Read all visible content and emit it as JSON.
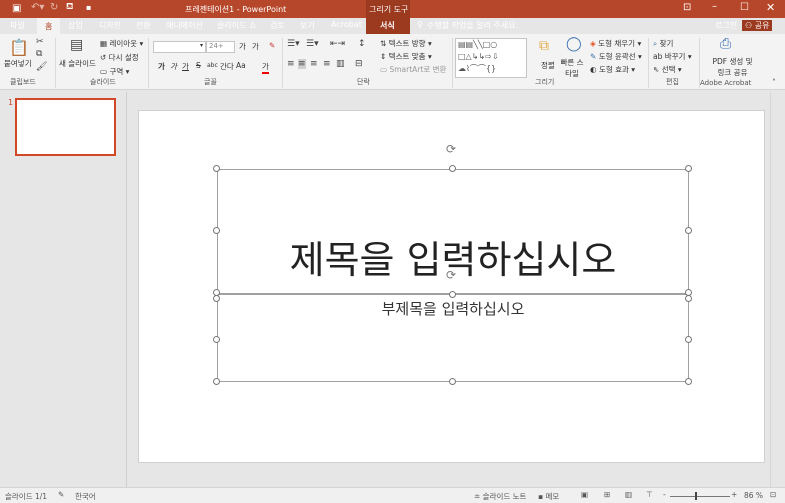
{
  "window": {
    "title": "프레젠테이션1 - PowerPoint",
    "context_tab_group": "그리기 도구"
  },
  "tabs": [
    {
      "label": "파일"
    },
    {
      "label": "홈"
    },
    {
      "label": "삽입"
    },
    {
      "label": "디자인"
    },
    {
      "label": "전환"
    },
    {
      "label": "애니메이션"
    },
    {
      "label": "슬라이드 쇼"
    },
    {
      "label": "검토"
    },
    {
      "label": "보기"
    },
    {
      "label": "Acrobat"
    },
    {
      "label": "서식"
    }
  ],
  "tell_me": "수행할 작업을 알려 주세요.",
  "signin": "로그인",
  "share": "공유",
  "ribbon": {
    "clipboard": {
      "paste": "붙여넣기",
      "group": "클립보드"
    },
    "slides": {
      "new_slide": "새 슬라이드",
      "layout": "레이아웃",
      "reset": "다시 설정",
      "section": "구역",
      "group": "슬라이드"
    },
    "font": {
      "font_size": "24+",
      "bold": "가",
      "italic": "가",
      "underline": "가",
      "strike": "S",
      "shadow": "abc",
      "spacing": "간다",
      "case": "Aa",
      "color": "가",
      "grow": "가",
      "shrink": "가",
      "group": "글꼴"
    },
    "paragraph": {
      "text_direction": "텍스트 방향",
      "align_text": "텍스트 맞춤",
      "smartart": "SmartArt로 변환",
      "group": "단락"
    },
    "drawing": {
      "arrange": "정렬",
      "quick_styles": "빠른 스타일",
      "fill": "도형 채우기",
      "outline": "도형 윤곽선",
      "effects": "도형 효과",
      "group": "그리기"
    },
    "editing": {
      "find": "찾기",
      "replace": "바꾸기",
      "select": "선택",
      "group": "편집"
    },
    "acrobat": {
      "pdf": "PDF 생성 및",
      "pdf2": "링크 공유",
      "group": "Adobe Acrobat"
    }
  },
  "thumbnail": {
    "number": "1"
  },
  "slide": {
    "title": "제목을 입력하십시오",
    "subtitle": "부제목을 입력하십시오"
  },
  "status": {
    "slide": "슬라이드 1/1",
    "language": "한국어",
    "notes": "슬라이드 노트",
    "comments": "메모",
    "zoom": "86 %",
    "zoom_percent": 86
  }
}
